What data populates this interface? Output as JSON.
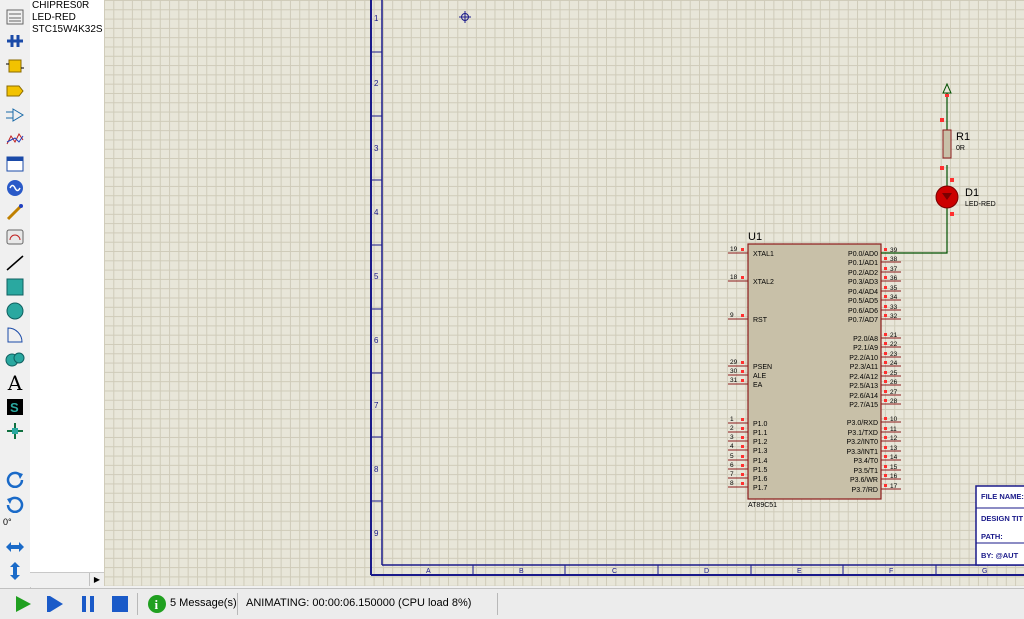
{
  "devices": {
    "items": [
      "CHIPRES0R",
      "LED-RED",
      "STC15W4K32S"
    ]
  },
  "toolbar": {
    "rotation": "0°"
  },
  "sheet": {
    "row_labels": [
      "1",
      "2",
      "3",
      "4",
      "5",
      "6",
      "7",
      "8",
      "9"
    ],
    "col_labels": [
      "A",
      "B",
      "C",
      "D",
      "E",
      "F",
      "G"
    ],
    "title_block": [
      "FILE NAME:",
      "DESIGN TIT",
      "PATH:",
      "BY:   @AUT"
    ]
  },
  "schematic": {
    "u1_ref": "U1",
    "u1_part": "AT89C51",
    "r1_ref": "R1",
    "r1_value": "0R",
    "d1_ref": "D1",
    "d1_value": "LED-RED",
    "left_pins": [
      {
        "num": "19",
        "name": "XTAL1"
      },
      {
        "num": "18",
        "name": "XTAL2"
      },
      {
        "num": "9",
        "name": "RST"
      },
      {
        "num": "29",
        "name": "PSEN"
      },
      {
        "num": "30",
        "name": "ALE"
      },
      {
        "num": "31",
        "name": "EA"
      },
      {
        "num": "1",
        "name": "P1.0"
      },
      {
        "num": "2",
        "name": "P1.1"
      },
      {
        "num": "3",
        "name": "P1.2"
      },
      {
        "num": "4",
        "name": "P1.3"
      },
      {
        "num": "5",
        "name": "P1.4"
      },
      {
        "num": "6",
        "name": "P1.5"
      },
      {
        "num": "7",
        "name": "P1.6"
      },
      {
        "num": "8",
        "name": "P1.7"
      }
    ],
    "right_pins": [
      {
        "num": "39",
        "name": "P0.0/AD0"
      },
      {
        "num": "38",
        "name": "P0.1/AD1"
      },
      {
        "num": "37",
        "name": "P0.2/AD2"
      },
      {
        "num": "36",
        "name": "P0.3/AD3"
      },
      {
        "num": "35",
        "name": "P0.4/AD4"
      },
      {
        "num": "34",
        "name": "P0.5/AD5"
      },
      {
        "num": "33",
        "name": "P0.6/AD6"
      },
      {
        "num": "32",
        "name": "P0.7/AD7"
      },
      {
        "num": "21",
        "name": "P2.0/A8"
      },
      {
        "num": "22",
        "name": "P2.1/A9"
      },
      {
        "num": "23",
        "name": "P2.2/A10"
      },
      {
        "num": "24",
        "name": "P2.3/A11"
      },
      {
        "num": "25",
        "name": "P2.4/A12"
      },
      {
        "num": "26",
        "name": "P2.5/A13"
      },
      {
        "num": "27",
        "name": "P2.6/A14"
      },
      {
        "num": "28",
        "name": "P2.7/A15"
      },
      {
        "num": "10",
        "name": "P3.0/RXD"
      },
      {
        "num": "11",
        "name": "P3.1/TXD"
      },
      {
        "num": "12",
        "name": "P3.2/INT0"
      },
      {
        "num": "13",
        "name": "P3.3/INT1"
      },
      {
        "num": "14",
        "name": "P3.4/T0"
      },
      {
        "num": "15",
        "name": "P3.5/T1"
      },
      {
        "num": "16",
        "name": "P3.6/WR"
      },
      {
        "num": "17",
        "name": "P3.7/RD"
      }
    ]
  },
  "status": {
    "messages": "5 Message(s)",
    "animating": "ANIMATING: 00:00:06.150000 (CPU load 8%)"
  },
  "colors": {
    "wire": "#005000",
    "part_fill": "#c8c0a8",
    "part_border": "#8b1a1a",
    "sheet_border": "#1a1a8a",
    "pin_marker": "#ff3030",
    "led": "#cc0000"
  }
}
